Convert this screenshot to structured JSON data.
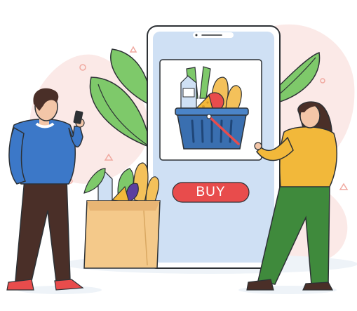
{
  "buy_button": {
    "label": "BUY"
  },
  "colors": {
    "phone_screen": "#cfe0f4",
    "phone_frame": "#2d3135",
    "buy_button": "#e84c4c",
    "leaf_green": "#7ec96a",
    "basket_blue": "#3a6fb0",
    "man_sweater": "#3c78c8",
    "woman_top": "#f2b83a",
    "woman_trousers": "#3f8a3c",
    "blob_pink": "#fbe9e7"
  },
  "illustration": {
    "scene": "online-grocery-shopping",
    "icons": [
      "phone-icon",
      "basket-icon",
      "bag-icon",
      "man-figure",
      "woman-figure",
      "leaf-icon"
    ]
  }
}
